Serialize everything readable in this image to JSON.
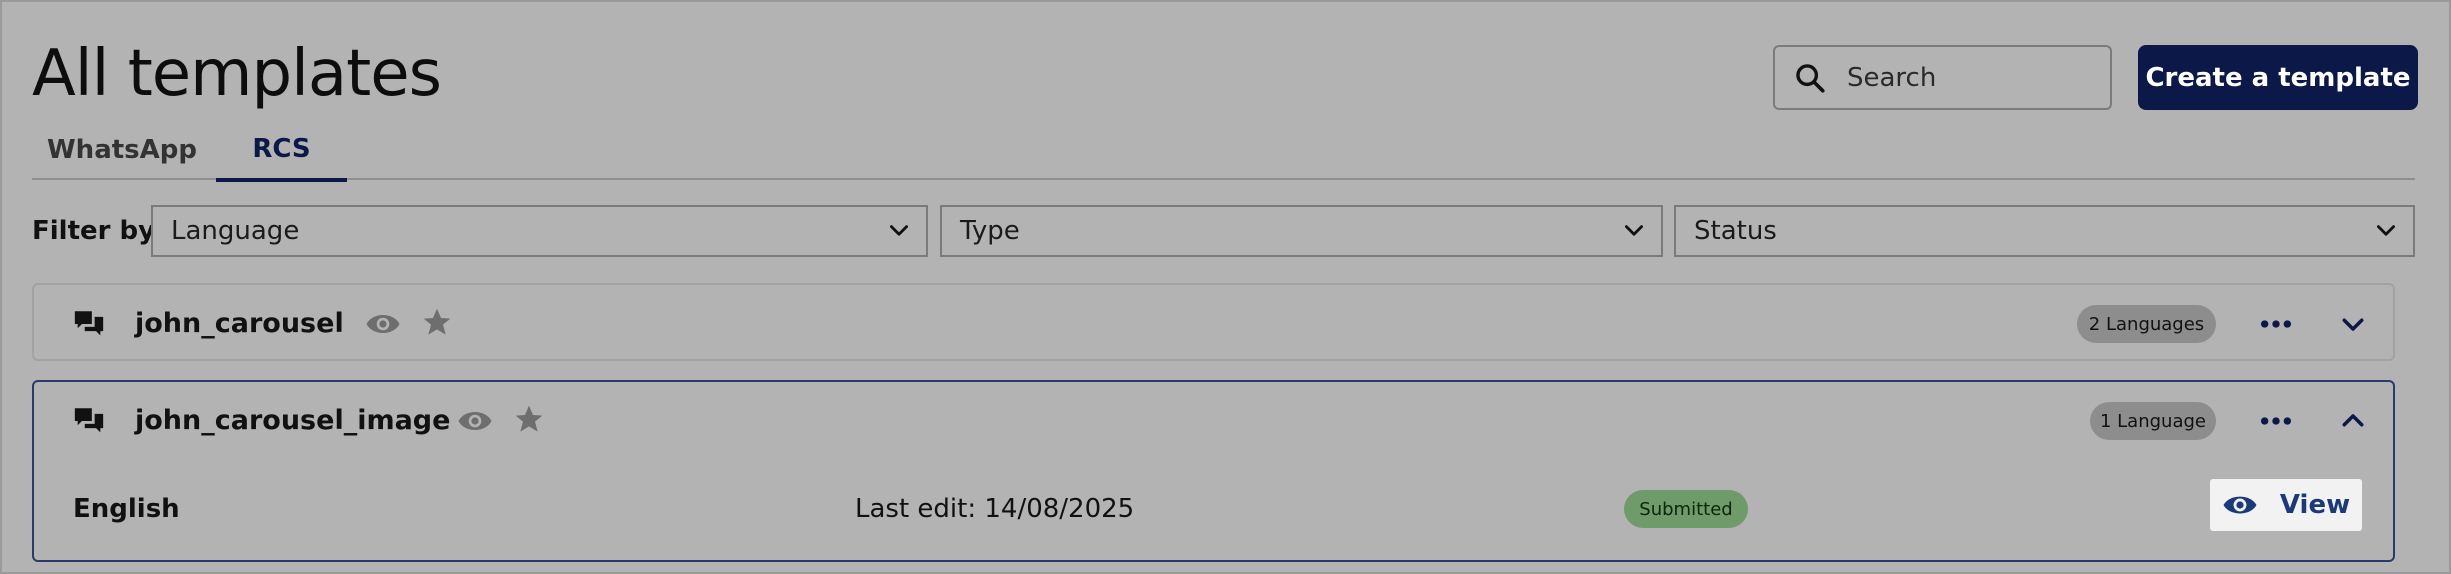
{
  "header": {
    "title": "All templates",
    "search_placeholder": "Search",
    "create_label": "Create a template"
  },
  "tabs": [
    {
      "label": "WhatsApp",
      "active": false
    },
    {
      "label": "RCS",
      "active": true
    }
  ],
  "filters": {
    "label": "Filter by:",
    "language": "Language",
    "type": "Type",
    "status": "Status"
  },
  "templates": [
    {
      "name": "john_carousel",
      "languages_badge": "2 Languages",
      "expanded": false
    },
    {
      "name": "john_carousel_image",
      "languages_badge": "1 Language",
      "expanded": true,
      "detail": {
        "language": "English",
        "last_edit": "Last edit: 14/08/2025",
        "status": "Submitted",
        "view_label": "View"
      }
    }
  ],
  "colors": {
    "primary": "#0b1848",
    "background": "#b3b3b3",
    "submitted_badge": "#6f9a6a",
    "view_text": "#1c3a78"
  },
  "icons": {
    "search": "search-icon",
    "chat": "chat-icon",
    "eye": "eye-icon",
    "star": "star-icon",
    "more": "more-icon",
    "chevron_down": "chevron-down-icon",
    "chevron_up": "chevron-up-icon"
  }
}
